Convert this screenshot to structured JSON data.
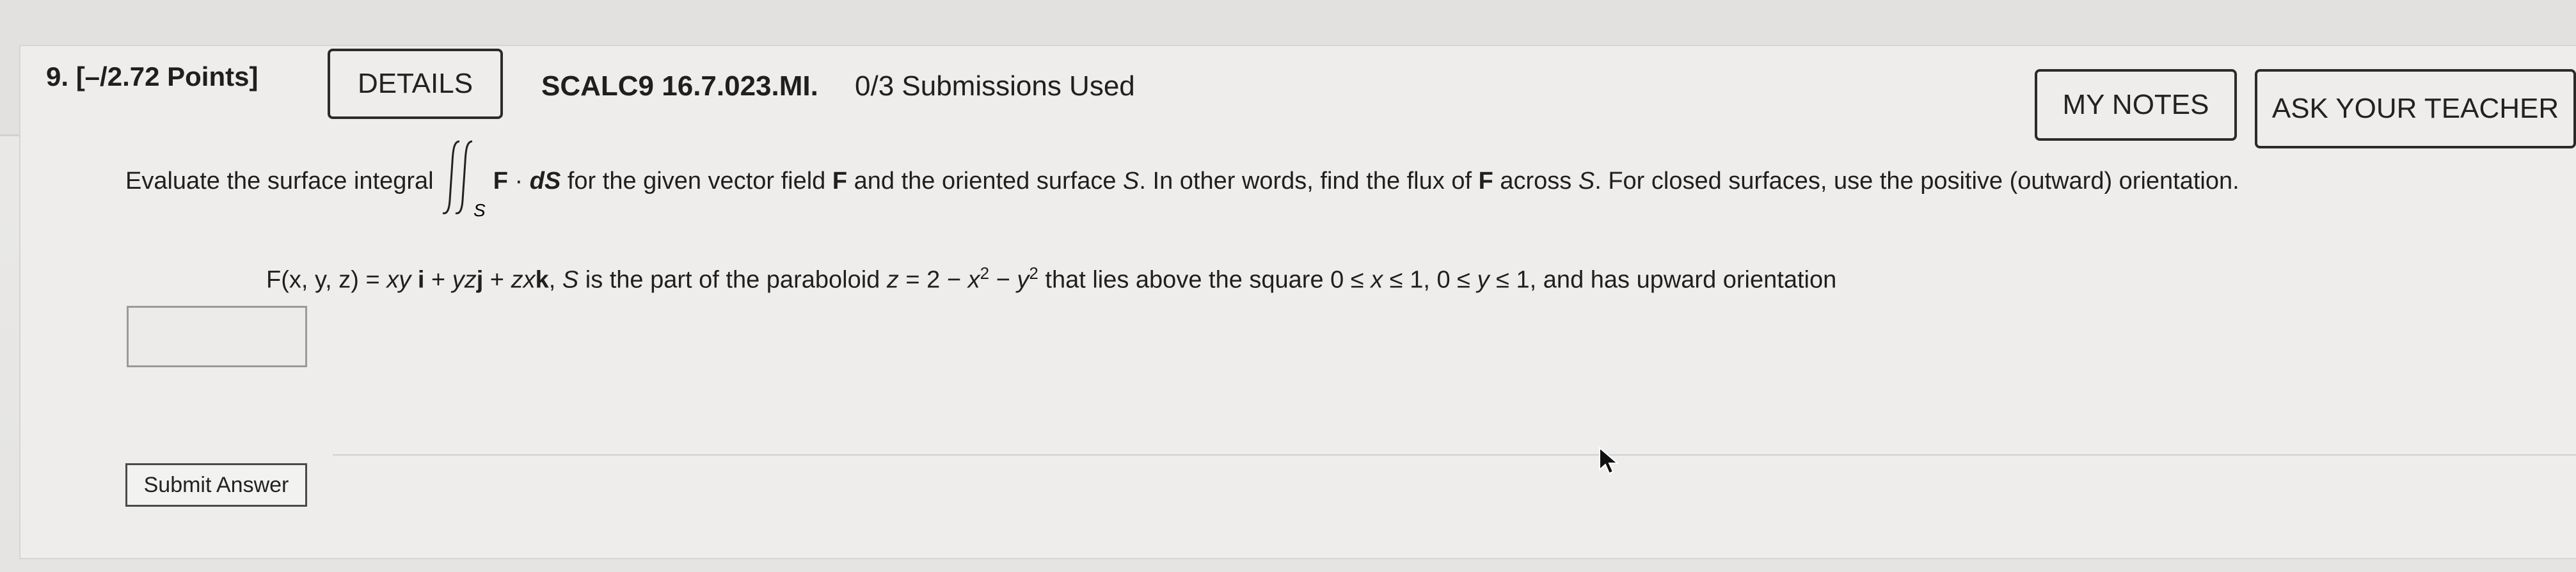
{
  "question": {
    "number_points": "9.  [–/2.72 Points]",
    "details_label": "DETAILS",
    "course_code": "SCALC9 16.7.023.MI.",
    "submissions": "0/3 Submissions Used",
    "my_notes_label": "MY NOTES",
    "ask_teacher_label": "ASK YOUR TEACHER"
  },
  "problem": {
    "intro": "Evaluate the surface integral",
    "integral_sub": "S",
    "integrand_F": "F",
    "dot": " · ",
    "dS": "dS",
    "rest_a": " for the given vector field ",
    "rest_F": "F",
    "rest_b": " and the oriented surface ",
    "rest_S": "S",
    "rest_c": ". In other words, find the flux of ",
    "rest_F2": "F",
    "rest_d": " across ",
    "rest_S2": "S",
    "rest_e": ". For closed surfaces, use the positive (outward) orientation."
  },
  "formula": {
    "lhs": "F(x, y, z) = ",
    "xy": "xy",
    "i": "i",
    "plus1": " + ",
    "yz": "yz",
    "j": "j",
    "plus2": " + ",
    "zx": "zx",
    "k": "k",
    "comma": ",   ",
    "S": "S",
    "desc1": " is the part of the paraboloid ",
    "z": "z",
    "eq": " = 2 − ",
    "x": "x",
    "exp1": "2",
    "minus": " − ",
    "y": "y",
    "exp2": "2",
    "desc2": " that lies above the square 0 ≤ ",
    "x2": "x",
    "desc3": " ≤ 1, 0 ≤ ",
    "y2": "y",
    "desc4": " ≤ 1, and has upward orientation"
  },
  "answer": {
    "value": ""
  },
  "submit_label": "Submit Answer"
}
